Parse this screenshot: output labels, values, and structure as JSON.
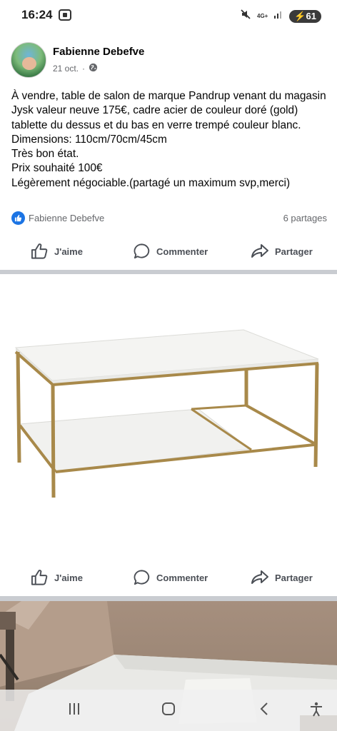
{
  "status_bar": {
    "time": "16:24",
    "network": "4G+",
    "battery": "61"
  },
  "post": {
    "author": "Fabienne Debefve",
    "date": "21 oct.",
    "meta_separator": "·",
    "privacy_icon": "globe-icon",
    "text_lines": [
      "À vendre, table de salon de marque Pandrup venant du magasin Jysk valeur neuve 175€, cadre acier de couleur doré (gold) tablette du dessus et du bas en verre trempé couleur blanc.",
      "Dimensions: 110cm/70cm/45cm",
      "Très bon état.",
      "Prix souhaité 100€",
      "Légèrement négociable.(partagé un maximum svp,merci)"
    ],
    "reactions": {
      "name": "Fabienne Debefve",
      "shares": "6 partages"
    }
  },
  "actions": {
    "like": "J'aime",
    "comment": "Commenter",
    "share": "Partager"
  },
  "colors": {
    "facebook_blue": "#1b74e4",
    "frame_gold": "#a8894a",
    "divider": "#c9ccd1"
  }
}
